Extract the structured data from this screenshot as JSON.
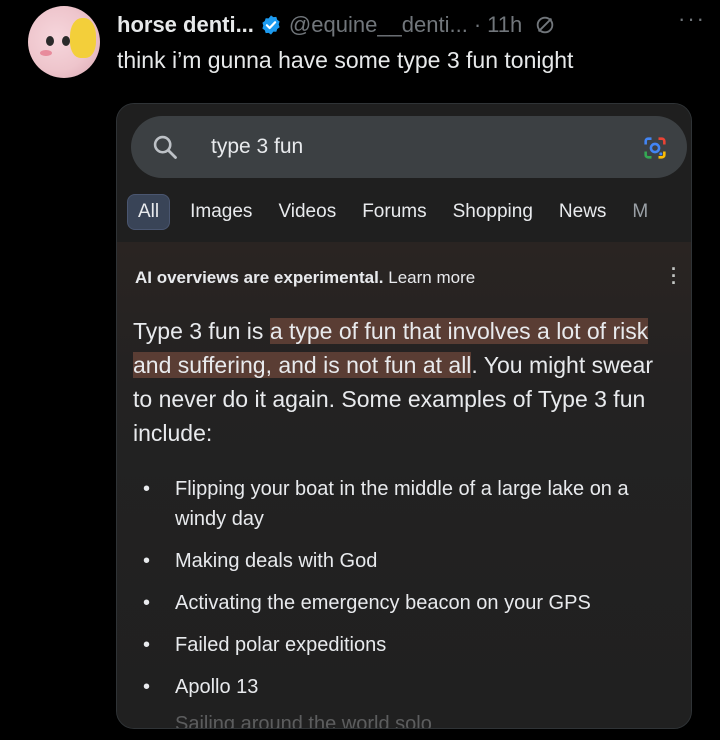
{
  "tweet": {
    "display_name": "horse denti...",
    "handle": "@equine__denti...",
    "separator": "·",
    "time": "11h",
    "text": "think i’m gunna have some type 3 fun tonight",
    "more_label": "···"
  },
  "search": {
    "query": "type 3 fun",
    "tabs": [
      "All",
      "Images",
      "Videos",
      "Forums",
      "Shopping",
      "News",
      "M"
    ]
  },
  "ai_overview": {
    "notice_bold": "AI overviews are experimental.",
    "learn_more": "Learn more",
    "summary_pre": "Type 3 fun is ",
    "summary_highlight": "a type of fun that involves a lot of risk and suffering, and is not fun at all",
    "summary_post": ". You might swear to never do it again. Some examples of Type 3 fun include:",
    "examples": [
      "Flipping your boat in the middle of a large lake on a windy day",
      "Making deals with God",
      "Activating the emergency beacon on your GPS",
      "Failed polar expeditions",
      "Apollo 13"
    ],
    "cutoff_item": "Sailing around the world solo"
  },
  "colors": {
    "background": "#000000",
    "verified": "#1d9bf0",
    "muted": "#71767b",
    "highlight": "#5a3d34"
  }
}
